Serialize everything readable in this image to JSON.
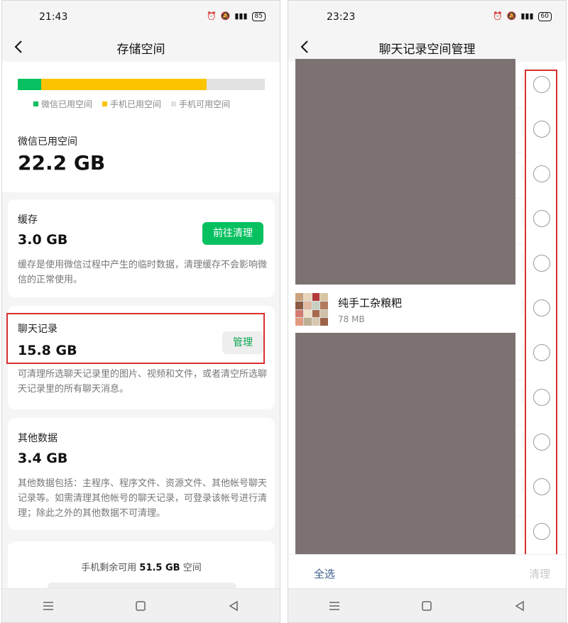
{
  "left": {
    "status": {
      "time": "21:43",
      "battery": "85"
    },
    "title": "存储空间",
    "legend": [
      {
        "label": "微信已用空间",
        "color": "#07c160"
      },
      {
        "label": "手机已用空间",
        "color": "#fcc300"
      },
      {
        "label": "手机可用空间",
        "color": "#e2e2e2"
      }
    ],
    "storage_fractions": {
      "wechat": 0.095,
      "phone_used": 0.67,
      "phone_free": 0.235
    },
    "wechat_used": {
      "label": "微信已用空间",
      "value": "22.2 GB"
    },
    "cache": {
      "title": "缓存",
      "value": "3.0 GB",
      "button": "前往清理",
      "desc": "缓存是使用微信过程中产生的临时数据，清理缓存不会影响微信的正常使用。"
    },
    "chat_history": {
      "title": "聊天记录",
      "value": "15.8 GB",
      "button": "管理",
      "desc": "可清理所选聊天记录里的图片、视频和文件，或者清空所选聊天记录里的所有聊天消息。"
    },
    "other": {
      "title": "其他数据",
      "value": "3.4 GB",
      "desc": "其他数据包括：主程序、程序文件、资源文件、其他帐号聊天记录等。如需清理其他帐号的聊天记录，可登录该帐号进行清理；除此之外的其他数据不可清理。"
    },
    "free": {
      "prefix": "手机剩余可用 ",
      "amount": "51.5 GB",
      "suffix": " 空间"
    }
  },
  "right": {
    "status": {
      "time": "23:23",
      "battery": "60"
    },
    "title": "聊天记录空间管理",
    "chat": {
      "name": "纯手工杂粮粑",
      "size": "78 MB"
    },
    "radio_count": 11,
    "footer": {
      "select_all": "全选",
      "clean": "清理"
    }
  },
  "colors": {
    "accent": "#07c160",
    "highlight": "#d83030",
    "redaction": "#7d7272"
  }
}
